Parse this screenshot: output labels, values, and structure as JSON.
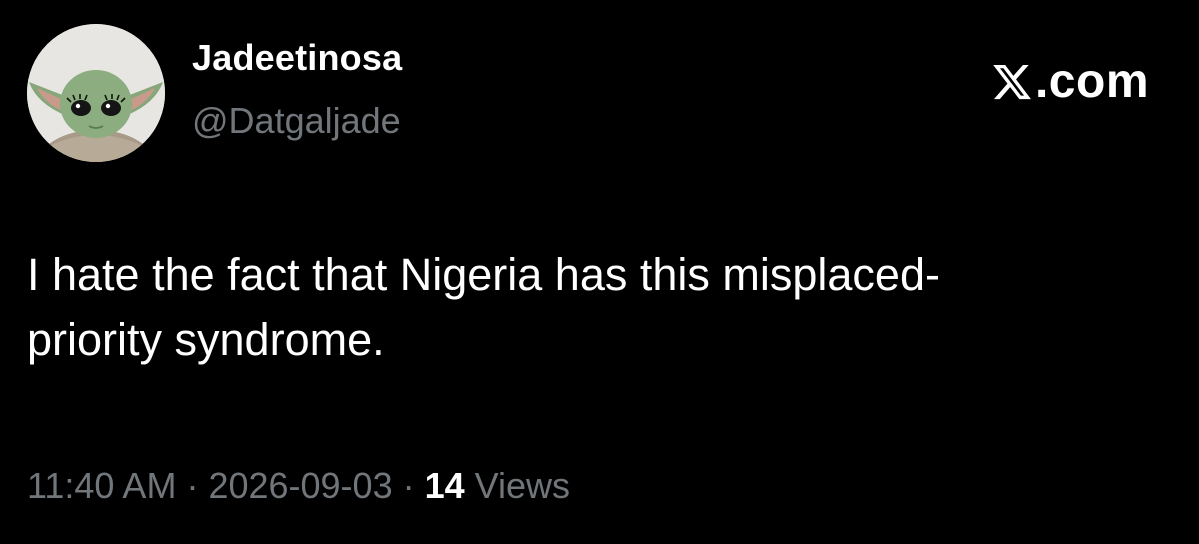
{
  "author": {
    "display_name": "Jadeetinosa",
    "handle": "@Datgaljade",
    "avatar_icon": "baby-yoda-avatar"
  },
  "brand": {
    "icon": "x-logo-icon",
    "suffix": ".com"
  },
  "tweet": {
    "lines": [
      "I hate the fact that Nigeria has this misplaced-",
      "priority syndrome."
    ]
  },
  "meta": {
    "time": "11:40 AM",
    "separator": " · ",
    "date": "2026-09-03",
    "views_count": "14",
    "views_label": " Views"
  },
  "colors": {
    "background": "#000000",
    "primary_text": "#ffffff",
    "secondary_text": "#71767b"
  }
}
